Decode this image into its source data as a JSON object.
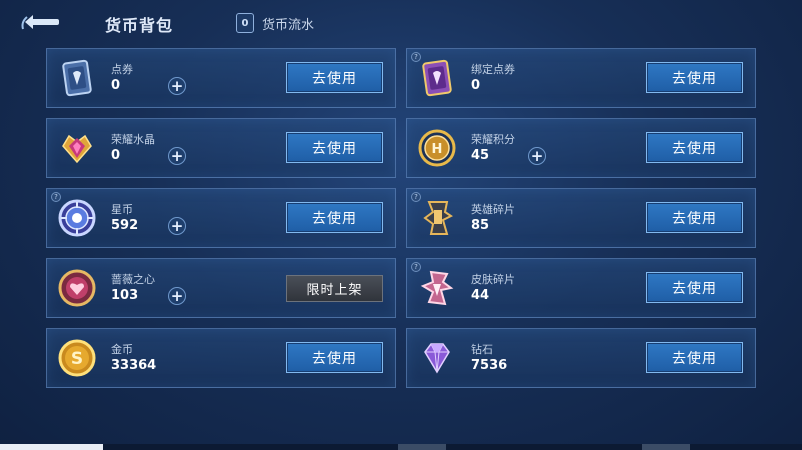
{
  "header": {
    "title": "货币背包",
    "flow_icon_glyph": "0",
    "flow_label": "货币流水"
  },
  "use_label": "去使用",
  "limited_label": "限时上架",
  "help_glyph": "?",
  "plus_glyph": "+",
  "colors": {
    "accent_button": "#2f78c4",
    "card_border": "#6e96cd",
    "background": "#172f57"
  },
  "currencies": [
    {
      "name": "点券",
      "count": "0",
      "icon": "voucher-card-icon"
    },
    {
      "name": "绑定点券",
      "count": "0",
      "icon": "bound-voucher-card-icon"
    },
    {
      "name": "荣耀水晶",
      "count": "0",
      "icon": "glory-crystal-icon"
    },
    {
      "name": "荣耀积分",
      "count": "45",
      "icon": "glory-points-icon"
    },
    {
      "name": "星币",
      "count": "592",
      "icon": "star-coin-icon"
    },
    {
      "name": "英雄碎片",
      "count": "85",
      "icon": "hero-fragment-icon"
    },
    {
      "name": "蔷薇之心",
      "count": "103",
      "icon": "rose-heart-icon"
    },
    {
      "name": "皮肤碎片",
      "count": "44",
      "icon": "skin-fragment-icon"
    },
    {
      "name": "金币",
      "count": "33364",
      "icon": "gold-coin-icon"
    },
    {
      "name": "钻石",
      "count": "7536",
      "icon": "diamond-icon"
    }
  ]
}
